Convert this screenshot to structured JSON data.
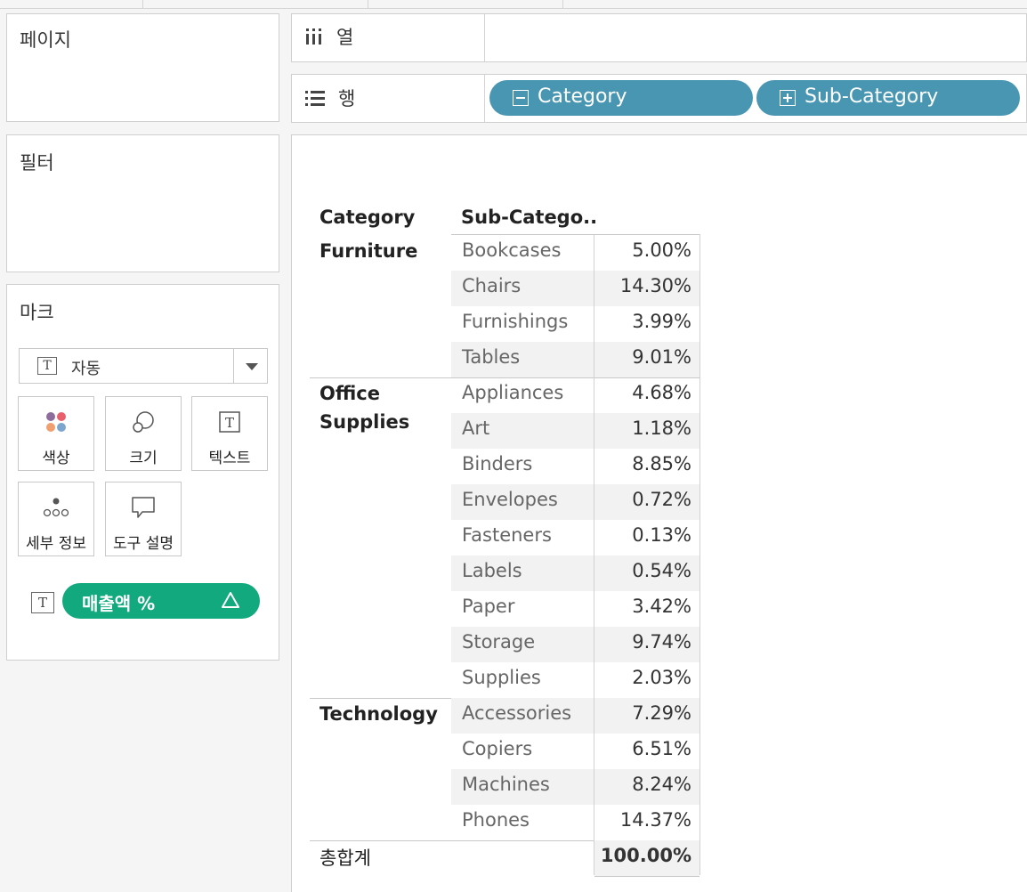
{
  "cards": {
    "pages_title": "페이지",
    "filters_title": "필터",
    "marks_title": "마크"
  },
  "marks": {
    "type_label": "자동",
    "buttons": [
      {
        "label": "색상",
        "icon": "color-dots-icon"
      },
      {
        "label": "크기",
        "icon": "size-circles-icon"
      },
      {
        "label": "텍스트",
        "icon": "text-T-icon"
      },
      {
        "label": "세부 정보",
        "icon": "detail-dots-icon"
      },
      {
        "label": "도구 설명",
        "icon": "tooltip-bubble-icon"
      }
    ],
    "measure_pill": "매출액 %",
    "measure_pill_color": "#13a97e",
    "color_dots": [
      "#8e6c9c",
      "#e8606b",
      "#f0a070",
      "#7da6cf"
    ]
  },
  "shelves": {
    "columns_label": "열",
    "rows_label": "행",
    "row_pills": [
      "Category",
      "Sub-Category"
    ],
    "pill_color": "#4996b2"
  },
  "table": {
    "headers": {
      "category": "Category",
      "sub_category": "Sub-Catego.."
    },
    "groups": [
      {
        "category": "Furniture",
        "rows": [
          {
            "sub": "Bookcases",
            "value": "5.00%"
          },
          {
            "sub": "Chairs",
            "value": "14.30%"
          },
          {
            "sub": "Furnishings",
            "value": "3.99%"
          },
          {
            "sub": "Tables",
            "value": "9.01%"
          }
        ]
      },
      {
        "category": "Office Supplies",
        "rows": [
          {
            "sub": "Appliances",
            "value": "4.68%"
          },
          {
            "sub": "Art",
            "value": "1.18%"
          },
          {
            "sub": "Binders",
            "value": "8.85%"
          },
          {
            "sub": "Envelopes",
            "value": "0.72%"
          },
          {
            "sub": "Fasteners",
            "value": "0.13%"
          },
          {
            "sub": "Labels",
            "value": "0.54%"
          },
          {
            "sub": "Paper",
            "value": "3.42%"
          },
          {
            "sub": "Storage",
            "value": "9.74%"
          },
          {
            "sub": "Supplies",
            "value": "2.03%"
          }
        ]
      },
      {
        "category": "Technology",
        "rows": [
          {
            "sub": "Accessories",
            "value": "7.29%"
          },
          {
            "sub": "Copiers",
            "value": "6.51%"
          },
          {
            "sub": "Machines",
            "value": "8.24%"
          },
          {
            "sub": "Phones",
            "value": "14.37%"
          }
        ]
      }
    ],
    "grand_total_label": "총합계",
    "grand_total_value": "100.00%"
  }
}
